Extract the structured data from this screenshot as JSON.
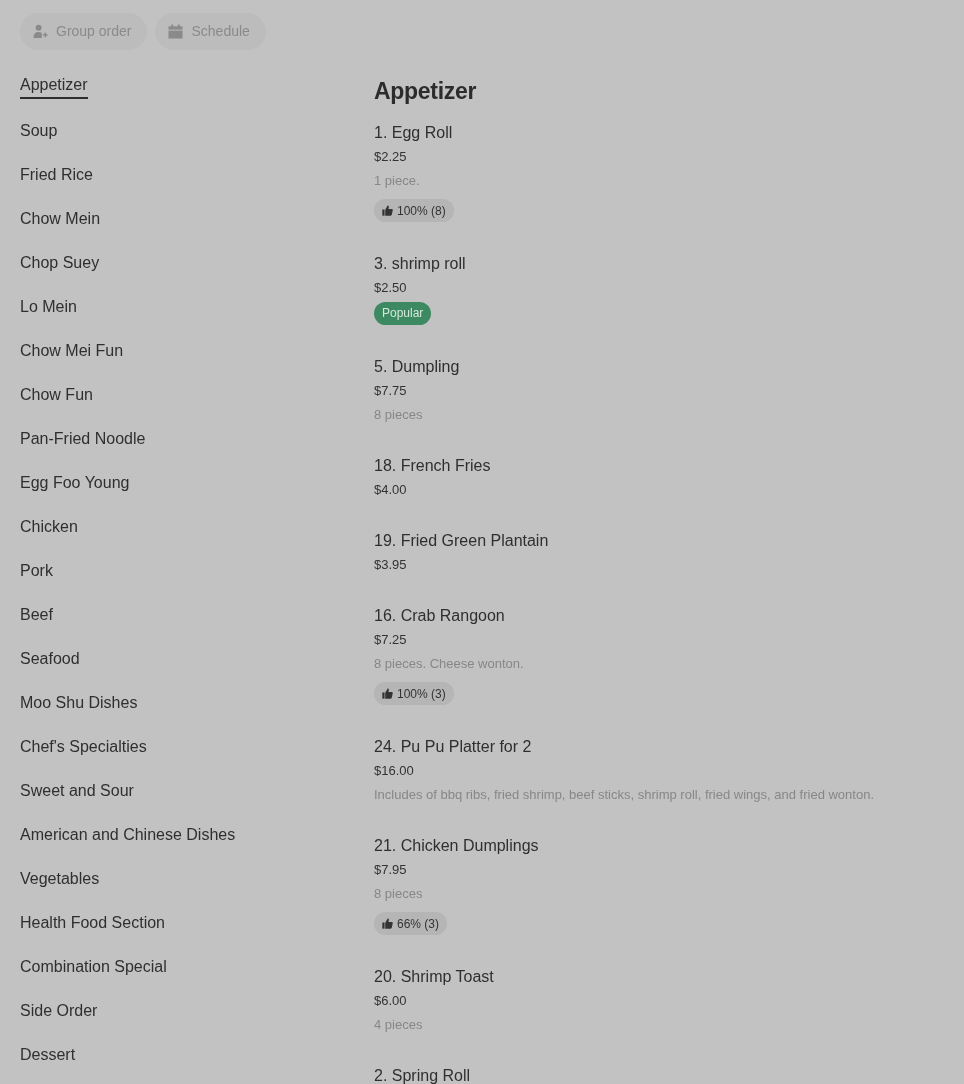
{
  "toolbar": {
    "buttons": [
      {
        "label": "Group order",
        "kind": "group"
      },
      {
        "label": "Schedule",
        "kind": "schedule"
      }
    ]
  },
  "categories": [
    {
      "label": "Appetizer",
      "selected": true
    },
    {
      "label": "Soup",
      "selected": false
    },
    {
      "label": "Fried Rice",
      "selected": false
    },
    {
      "label": "Chow Mein",
      "selected": false
    },
    {
      "label": "Chop Suey",
      "selected": false
    },
    {
      "label": "Lo Mein",
      "selected": false
    },
    {
      "label": "Chow Mei Fun",
      "selected": false
    },
    {
      "label": "Chow Fun",
      "selected": false
    },
    {
      "label": "Pan-Fried Noodle",
      "selected": false
    },
    {
      "label": "Egg Foo Young",
      "selected": false
    },
    {
      "label": "Chicken",
      "selected": false
    },
    {
      "label": "Pork",
      "selected": false
    },
    {
      "label": "Beef",
      "selected": false
    },
    {
      "label": "Seafood",
      "selected": false
    },
    {
      "label": "Moo Shu Dishes",
      "selected": false
    },
    {
      "label": "Chef's Specialties",
      "selected": false
    },
    {
      "label": "Sweet and Sour",
      "selected": false
    },
    {
      "label": "American and Chinese Dishes",
      "selected": false
    },
    {
      "label": "Vegetables",
      "selected": false
    },
    {
      "label": "Health Food Section",
      "selected": false
    },
    {
      "label": "Combination Special",
      "selected": false
    },
    {
      "label": "Side Order",
      "selected": false
    },
    {
      "label": "Dessert",
      "selected": false
    }
  ],
  "section": {
    "title": "Appetizer",
    "items": [
      {
        "name": "1. Egg Roll",
        "price": "$2.25",
        "description": "1 piece.",
        "rating": "100% (8)"
      },
      {
        "name": "3. shrimp roll",
        "price": "$2.50",
        "badge": "Popular"
      },
      {
        "name": "5. Dumpling",
        "price": "$7.75",
        "description": "8 pieces"
      },
      {
        "name": "18. French Fries",
        "price": "$4.00"
      },
      {
        "name": "19. Fried Green Plantain",
        "price": "$3.95"
      },
      {
        "name": "16. Crab Rangoon",
        "price": "$7.25",
        "description": "8 pieces. Cheese wonton.",
        "rating": "100% (3)"
      },
      {
        "name": "24. Pu Pu Platter for 2",
        "price": "$16.00",
        "description": "Includes of bbq ribs, fried shrimp, beef sticks, shrimp roll, fried wings, and fried wonton."
      },
      {
        "name": "21. Chicken Dumplings",
        "price": "$7.95",
        "description": "8 pieces",
        "rating": "66% (3)"
      },
      {
        "name": "20. Shrimp Toast",
        "price": "$6.00",
        "description": "4 pieces"
      },
      {
        "name": "2. Spring Roll"
      }
    ]
  }
}
